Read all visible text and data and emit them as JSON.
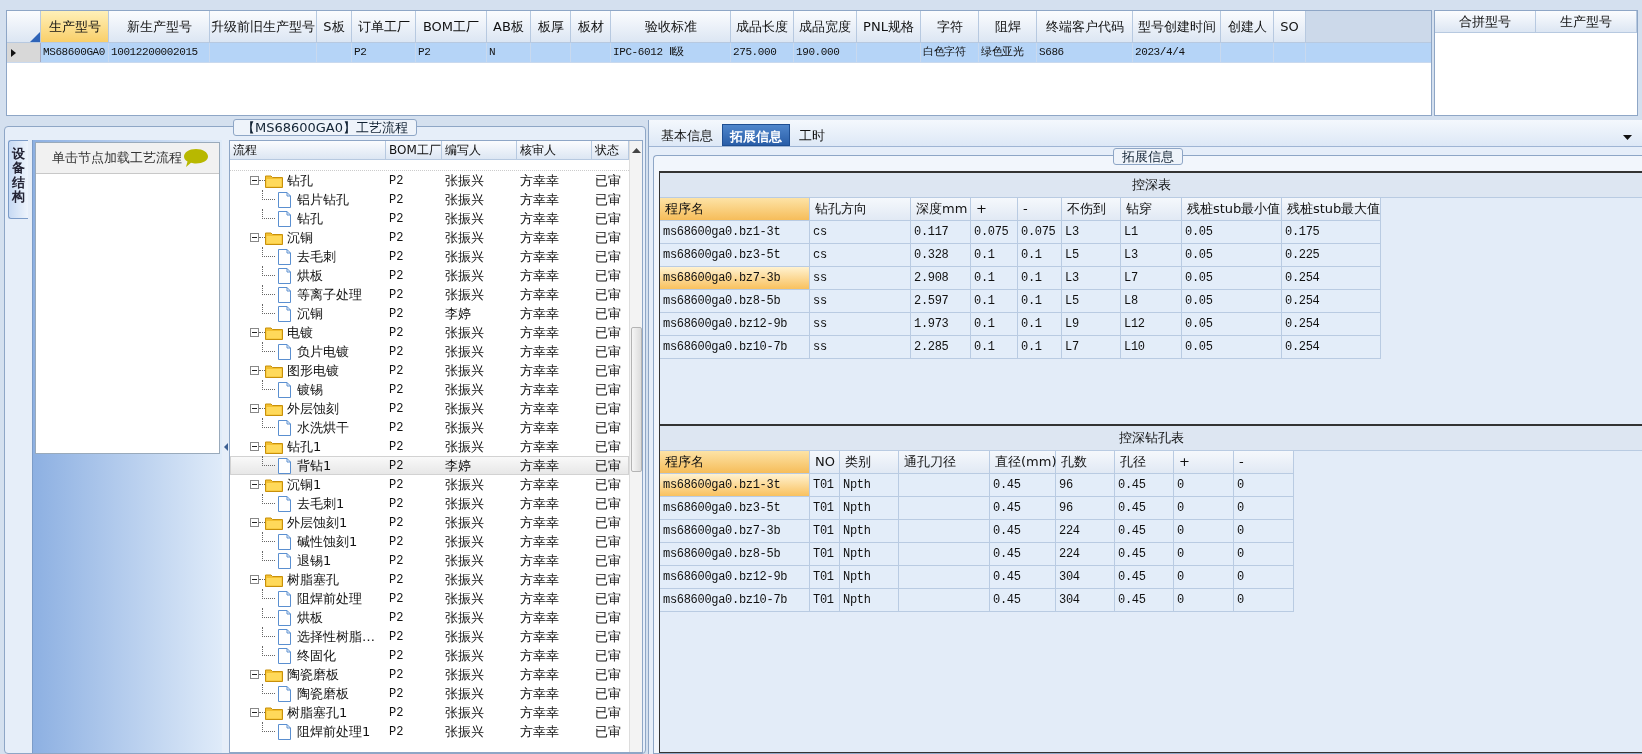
{
  "top_grid": {
    "columns": [
      "生产型号",
      "新生产型号",
      "升级前旧生产型号",
      "S板",
      "订单工厂",
      "BOM工厂",
      "AB板",
      "板厚",
      "板材",
      "验收标准",
      "成品长度",
      "成品宽度",
      "PNL规格",
      "字符",
      "阻焊",
      "终端客户代码",
      "型号创建时间",
      "创建人",
      "SO"
    ],
    "rows": [
      {
        "selected": true,
        "cells": [
          "MS68600GA0",
          "10012200002015",
          null,
          null,
          "P2",
          "P2",
          "N",
          null,
          null,
          "IPC-6012 Ⅱ级",
          "275.000",
          "190.000",
          null,
          "白色字符",
          "绿色亚光",
          "S686",
          "2023/4/4",
          null,
          null
        ]
      }
    ]
  },
  "merge_panel": {
    "columns": [
      "合拼型号",
      "生产型号"
    ]
  },
  "flow": {
    "title": "【MS68600GA0】工艺流程",
    "side_tab": "设备结构",
    "hint": "单击节点加载工艺流程",
    "columns": [
      "流程",
      "BOM工厂",
      "编写人",
      "核审人",
      "状态"
    ],
    "tree": [
      {
        "name": "钻孔",
        "bom": "P2",
        "writer": "张振兴",
        "reviewer": "方幸幸",
        "status": "已审",
        "selected": false,
        "expanded": true,
        "children": [
          {
            "name": "铝片钻孔",
            "bom": "P2",
            "writer": "张振兴",
            "reviewer": "方幸幸",
            "status": "已审",
            "selected": false
          },
          {
            "name": "钻孔",
            "bom": "P2",
            "writer": "张振兴",
            "reviewer": "方幸幸",
            "status": "已审",
            "selected": false
          }
        ]
      },
      {
        "name": "沉铜",
        "bom": "P2",
        "writer": "张振兴",
        "reviewer": "方幸幸",
        "status": "已审",
        "selected": false,
        "expanded": true,
        "children": [
          {
            "name": "去毛刺",
            "bom": "P2",
            "writer": "张振兴",
            "reviewer": "方幸幸",
            "status": "已审",
            "selected": false
          },
          {
            "name": "烘板",
            "bom": "P2",
            "writer": "张振兴",
            "reviewer": "方幸幸",
            "status": "已审",
            "selected": false
          },
          {
            "name": "等离子处理",
            "bom": "P2",
            "writer": "张振兴",
            "reviewer": "方幸幸",
            "status": "已审",
            "selected": false
          },
          {
            "name": "沉铜",
            "bom": "P2",
            "writer": "李婷",
            "reviewer": "方幸幸",
            "status": "已审",
            "selected": false
          }
        ]
      },
      {
        "name": "电镀",
        "bom": "P2",
        "writer": "张振兴",
        "reviewer": "方幸幸",
        "status": "已审",
        "selected": false,
        "expanded": true,
        "children": [
          {
            "name": "负片电镀",
            "bom": "P2",
            "writer": "张振兴",
            "reviewer": "方幸幸",
            "status": "已审",
            "selected": false
          }
        ]
      },
      {
        "name": "图形电镀",
        "bom": "P2",
        "writer": "张振兴",
        "reviewer": "方幸幸",
        "status": "已审",
        "selected": false,
        "expanded": true,
        "children": [
          {
            "name": "镀锡",
            "bom": "P2",
            "writer": "张振兴",
            "reviewer": "方幸幸",
            "status": "已审",
            "selected": false
          }
        ]
      },
      {
        "name": "外层蚀刻",
        "bom": "P2",
        "writer": "张振兴",
        "reviewer": "方幸幸",
        "status": "已审",
        "selected": false,
        "expanded": true,
        "children": [
          {
            "name": "水洗烘干",
            "bom": "P2",
            "writer": "张振兴",
            "reviewer": "方幸幸",
            "status": "已审",
            "selected": false
          }
        ]
      },
      {
        "name": "钻孔1",
        "bom": "P2",
        "writer": "张振兴",
        "reviewer": "方幸幸",
        "status": "已审",
        "selected": false,
        "expanded": true,
        "children": [
          {
            "name": "背钻1",
            "bom": "P2",
            "writer": "李婷",
            "reviewer": "方幸幸",
            "status": "已审",
            "selected": true
          }
        ]
      },
      {
        "name": "沉铜1",
        "bom": "P2",
        "writer": "张振兴",
        "reviewer": "方幸幸",
        "status": "已审",
        "selected": false,
        "expanded": true,
        "children": [
          {
            "name": "去毛刺1",
            "bom": "P2",
            "writer": "张振兴",
            "reviewer": "方幸幸",
            "status": "已审",
            "selected": false
          }
        ]
      },
      {
        "name": "外层蚀刻1",
        "bom": "P2",
        "writer": "张振兴",
        "reviewer": "方幸幸",
        "status": "已审",
        "selected": false,
        "expanded": true,
        "children": [
          {
            "name": "碱性蚀刻1",
            "bom": "P2",
            "writer": "张振兴",
            "reviewer": "方幸幸",
            "status": "已审",
            "selected": false
          },
          {
            "name": "退锡1",
            "bom": "P2",
            "writer": "张振兴",
            "reviewer": "方幸幸",
            "status": "已审",
            "selected": false
          }
        ]
      },
      {
        "name": "树脂塞孔",
        "bom": "P2",
        "writer": "张振兴",
        "reviewer": "方幸幸",
        "status": "已审",
        "selected": false,
        "expanded": true,
        "children": [
          {
            "name": "阻焊前处理",
            "bom": "P2",
            "writer": "张振兴",
            "reviewer": "方幸幸",
            "status": "已审",
            "selected": false
          },
          {
            "name": "烘板",
            "bom": "P2",
            "writer": "张振兴",
            "reviewer": "方幸幸",
            "status": "已审",
            "selected": false
          },
          {
            "name": "选择性树脂…",
            "bom": "P2",
            "writer": "张振兴",
            "reviewer": "方幸幸",
            "status": "已审",
            "selected": false
          },
          {
            "name": "终固化",
            "bom": "P2",
            "writer": "张振兴",
            "reviewer": "方幸幸",
            "status": "已审",
            "selected": false
          }
        ]
      },
      {
        "name": "陶瓷磨板",
        "bom": "P2",
        "writer": "张振兴",
        "reviewer": "方幸幸",
        "status": "已审",
        "selected": false,
        "expanded": true,
        "children": [
          {
            "name": "陶瓷磨板",
            "bom": "P2",
            "writer": "张振兴",
            "reviewer": "方幸幸",
            "status": "已审",
            "selected": false
          }
        ]
      },
      {
        "name": "树脂塞孔1",
        "bom": "P2",
        "writer": "张振兴",
        "reviewer": "方幸幸",
        "status": "已审",
        "selected": false,
        "expanded": true,
        "children": [
          {
            "name": "阻焊前处理1",
            "bom": "P2",
            "writer": "张振兴",
            "reviewer": "方幸幸",
            "status": "已审",
            "selected": false
          }
        ]
      }
    ]
  },
  "detail": {
    "tabs": [
      {
        "label": "基本信息",
        "selected": false
      },
      {
        "label": "拓展信息",
        "selected": true
      },
      {
        "label": "工时",
        "selected": false
      }
    ],
    "group_title": "拓展信息",
    "tables": [
      {
        "title": "控深表",
        "columns": [
          "程序名",
          "钻孔方向",
          "深度mm",
          "+",
          "-",
          "不伤到",
          "钻穿",
          "残桩stub最小值",
          "残桩stub最大值"
        ],
        "rows": [
          {
            "selected": false,
            "cells": [
              "ms68600ga0.bz1-3t",
              "cs",
              "0.117",
              "0.075",
              "0.075",
              "L3",
              "L1",
              "0.05",
              "0.175"
            ]
          },
          {
            "selected": false,
            "cells": [
              "ms68600ga0.bz3-5t",
              "cs",
              "0.328",
              "0.1",
              "0.1",
              "L5",
              "L3",
              "0.05",
              "0.225"
            ]
          },
          {
            "selected": true,
            "cells": [
              "ms68600ga0.bz7-3b",
              "ss",
              "2.908",
              "0.1",
              "0.1",
              "L3",
              "L7",
              "0.05",
              "0.254"
            ]
          },
          {
            "selected": false,
            "cells": [
              "ms68600ga0.bz8-5b",
              "ss",
              "2.597",
              "0.1",
              "0.1",
              "L5",
              "L8",
              "0.05",
              "0.254"
            ]
          },
          {
            "selected": false,
            "cells": [
              "ms68600ga0.bz12-9b",
              "ss",
              "1.973",
              "0.1",
              "0.1",
              "L9",
              "L12",
              "0.05",
              "0.254"
            ]
          },
          {
            "selected": false,
            "cells": [
              "ms68600ga0.bz10-7b",
              "ss",
              "2.285",
              "0.1",
              "0.1",
              "L7",
              "L10",
              "0.05",
              "0.254"
            ]
          }
        ]
      },
      {
        "title": "控深钻孔表",
        "columns": [
          "程序名",
          "NO",
          "类别",
          "通孔刀径",
          "直径(mm)",
          "孔数",
          "孔径",
          "+",
          "-"
        ],
        "rows": [
          {
            "selected": true,
            "cells": [
              "ms68600ga0.bz1-3t",
              "T01",
              "Npth",
              null,
              "0.45",
              "96",
              "0.45",
              "0",
              "0"
            ]
          },
          {
            "selected": false,
            "cells": [
              "ms68600ga0.bz3-5t",
              "T01",
              "Npth",
              null,
              "0.45",
              "96",
              "0.45",
              "0",
              "0"
            ]
          },
          {
            "selected": false,
            "cells": [
              "ms68600ga0.bz7-3b",
              "T01",
              "Npth",
              null,
              "0.45",
              "224",
              "0.45",
              "0",
              "0"
            ]
          },
          {
            "selected": false,
            "cells": [
              "ms68600ga0.bz8-5b",
              "T01",
              "Npth",
              null,
              "0.45",
              "224",
              "0.45",
              "0",
              "0"
            ]
          },
          {
            "selected": false,
            "cells": [
              "ms68600ga0.bz12-9b",
              "T01",
              "Npth",
              null,
              "0.45",
              "304",
              "0.45",
              "0",
              "0"
            ]
          },
          {
            "selected": false,
            "cells": [
              "ms68600ga0.bz10-7b",
              "T01",
              "Npth",
              null,
              "0.45",
              "304",
              "0.45",
              "0",
              "0"
            ]
          }
        ]
      }
    ]
  }
}
